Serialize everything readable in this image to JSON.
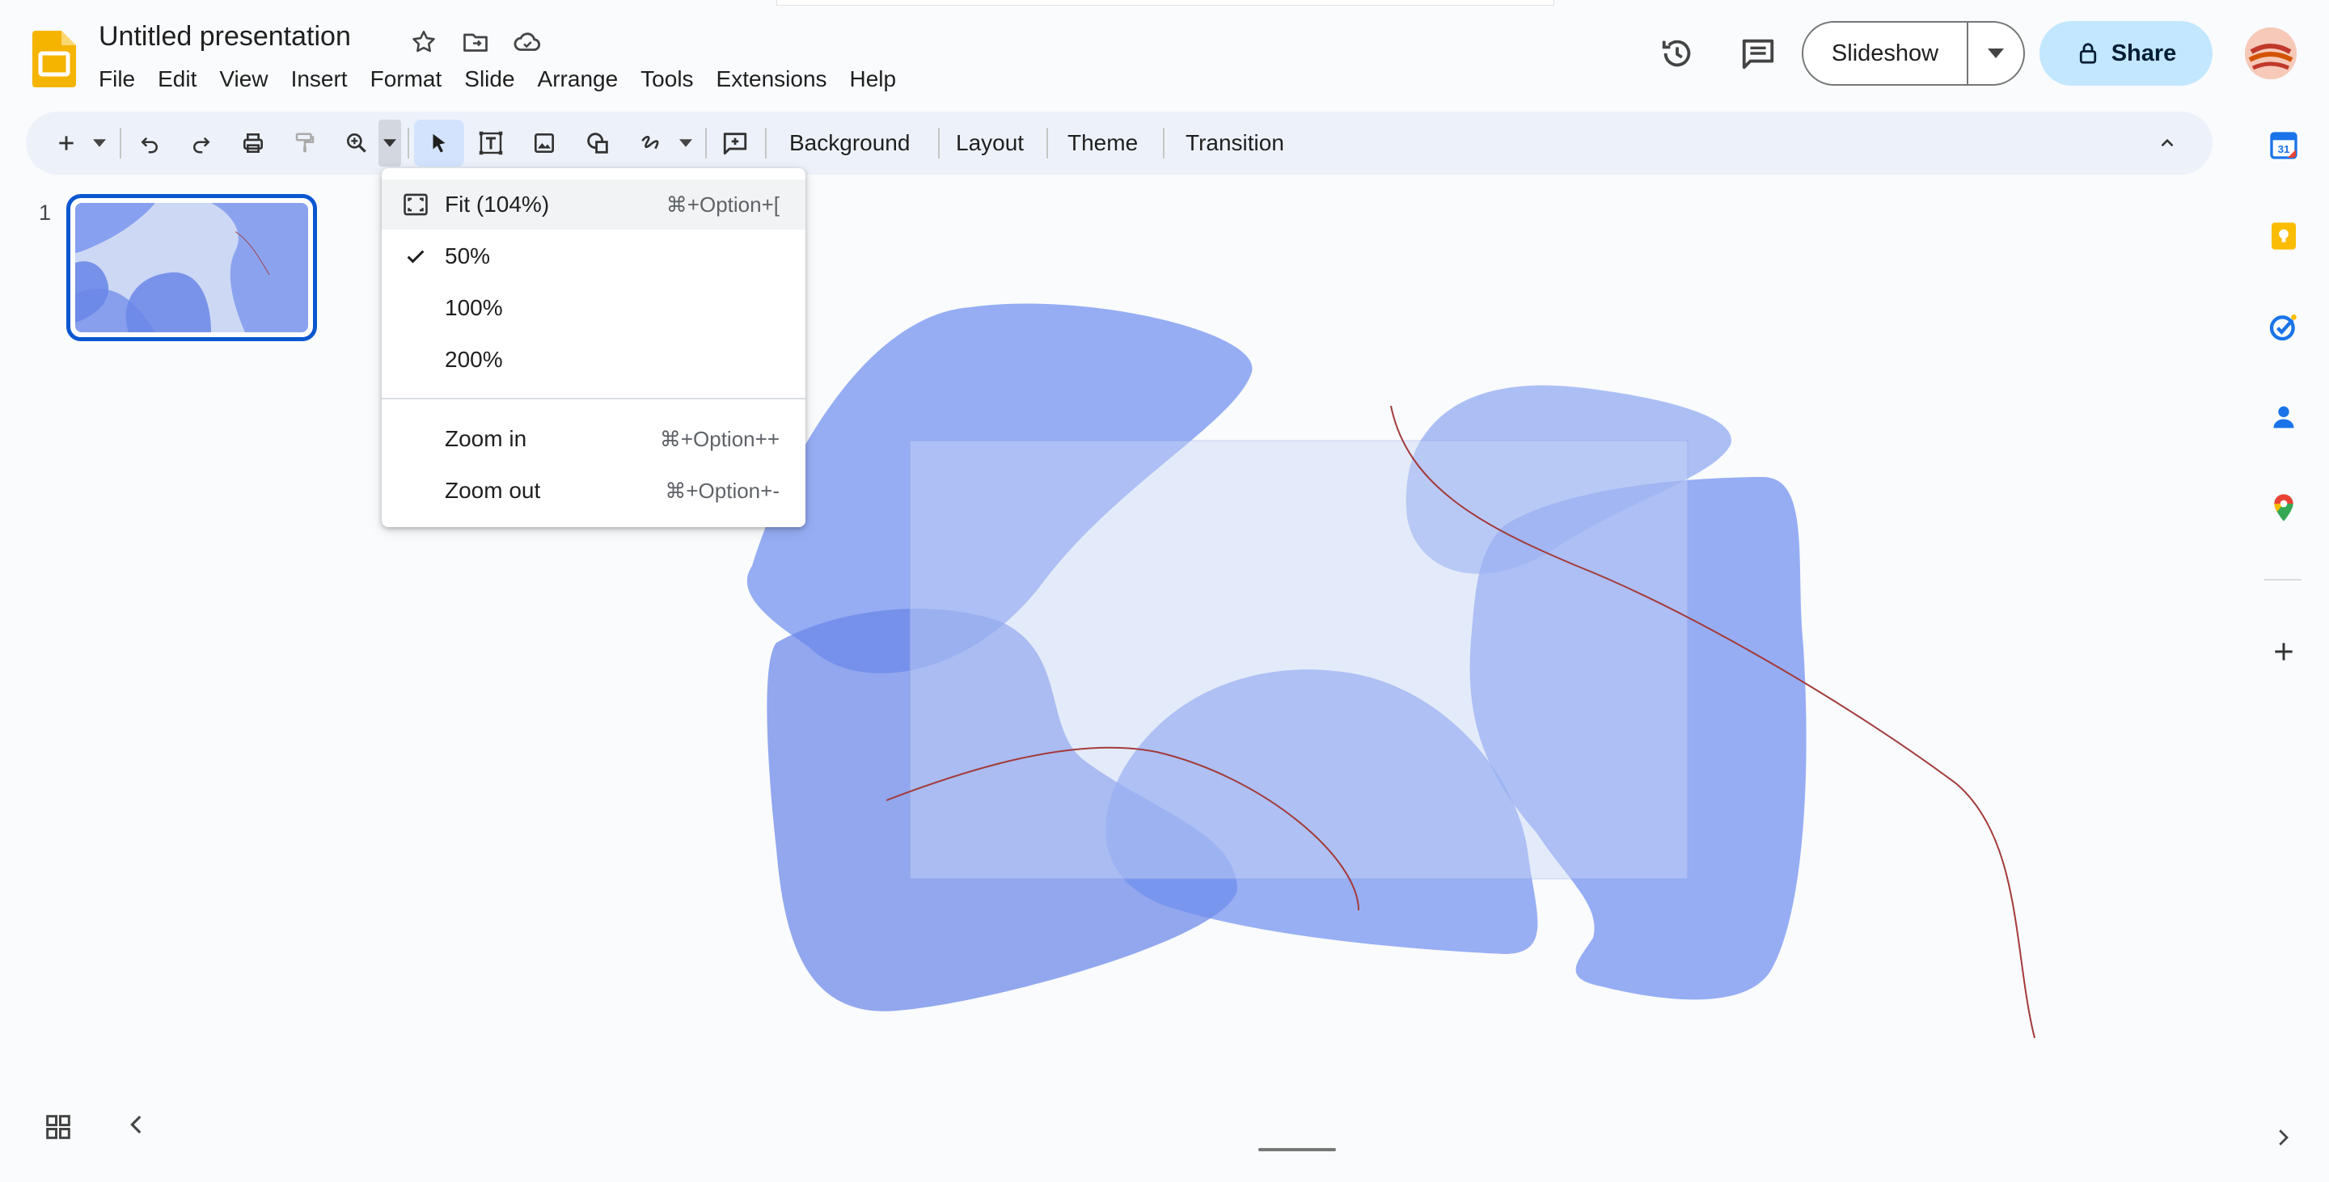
{
  "header": {
    "title": "Untitled presentation",
    "menu": [
      "File",
      "Edit",
      "View",
      "Insert",
      "Format",
      "Slide",
      "Arrange",
      "Tools",
      "Extensions",
      "Help"
    ],
    "slideshow_label": "Slideshow",
    "share_label": "Share"
  },
  "toolbar": {
    "text_buttons": [
      "Background",
      "Layout",
      "Theme",
      "Transition"
    ]
  },
  "filmstrip": {
    "slide_number": "1"
  },
  "zoom_menu": {
    "items": [
      {
        "label": "Fit (104%)",
        "shortcut": "⌘+Option+[",
        "icon": "fit-screen-icon",
        "highlighted": true
      },
      {
        "label": "50%",
        "shortcut": "",
        "icon": "check-icon",
        "checked": true
      },
      {
        "label": "100%",
        "shortcut": ""
      },
      {
        "label": "200%",
        "shortcut": ""
      },
      {
        "label": "Zoom in",
        "shortcut": "⌘+Option++"
      },
      {
        "label": "Zoom out",
        "shortcut": "⌘+Option+-"
      }
    ]
  },
  "colors": {
    "accent": "#0b57d0",
    "share_bg": "#c2e7ff",
    "toolbar_bg": "#edf2fa",
    "blob_blue": "#6f8ff0",
    "line_red": "#a33a3a"
  },
  "side_panel": [
    "calendar-icon",
    "keep-icon",
    "tasks-icon",
    "contacts-icon",
    "maps-icon"
  ]
}
